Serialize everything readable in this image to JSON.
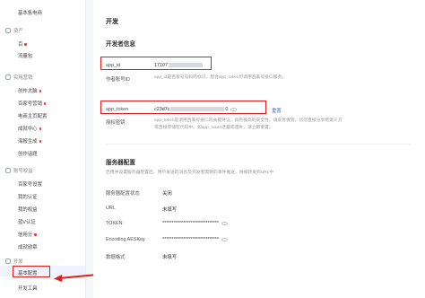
{
  "sidebar": {
    "items_top": [
      {
        "label": "基本售电商",
        "dot": false
      }
    ],
    "group_assets": {
      "label": "资产"
    },
    "assets_items": [
      {
        "label": "百",
        "dot": true
      },
      {
        "label": "流量包",
        "dot": false
      }
    ],
    "group_practical": {
      "label": "实用营销"
    },
    "practical_items": [
      {
        "label": "创作大脑",
        "dot": true
      },
      {
        "label": "百家号营销",
        "dot": true
      },
      {
        "label": "电商主页配置",
        "dot": false
      },
      {
        "label": "成就中心",
        "dot": true
      },
      {
        "label": "海报生成",
        "dot": true
      },
      {
        "label": "创作话题",
        "dot": false
      }
    ],
    "group_account": {
      "label": "账号权益"
    },
    "account_items": [
      {
        "label": "百家号设置",
        "dot": false
      },
      {
        "label": "我的认证",
        "dot": false
      },
      {
        "label": "我的权益",
        "dot": false
      },
      {
        "label": "蓝V认证",
        "dot": false
      },
      {
        "label": "信用分",
        "dot": true
      },
      {
        "label": "成就勋章",
        "dot": false
      }
    ],
    "group_dev": {
      "label": "开发"
    },
    "dev_items": [
      {
        "label": "基本配置",
        "dot": false
      },
      {
        "label": "开发工具",
        "dot": false
      }
    ]
  },
  "main": {
    "title": "开发",
    "dev_info_title": "开发者信息",
    "app_id_label": "app_id",
    "app_id_value": "17107",
    "author_id_label": "作者账号ID",
    "author_id_desc": "app_id是百家号号码的标识，配合app_token可调用百家号接口服务。",
    "app_token_label": "app_token",
    "app_token_prefix": "c23d7c",
    "app_token_suffix": "0",
    "reset_label": "重置",
    "auth_label": "授权密钥",
    "auth_desc": "app_token是调用百家号接口的关键凭证，具有极高的安全性。请妥善保管，切勿直接分享给第三方或直接存储在代码中。如app_token泄露或遗失，请立即重置。",
    "server_title": "服务器配置",
    "server_desc": "启用并设置服务器配置后，用户发送的消息及开发者需要的事件推送，将被转发到URL中",
    "server_status_label": "服务器配置状态",
    "server_status_value": "关闭",
    "url_label": "URL",
    "url_value": "未填写",
    "token_label": "TOKEN",
    "token_value": "******************************",
    "aes_label": "Encoding AESKey",
    "aes_value": "******************************",
    "format_label": "数据格式",
    "format_value": "未填写"
  },
  "colors": {
    "highlight": "#e11d1d",
    "link": "#3a6ee8"
  }
}
